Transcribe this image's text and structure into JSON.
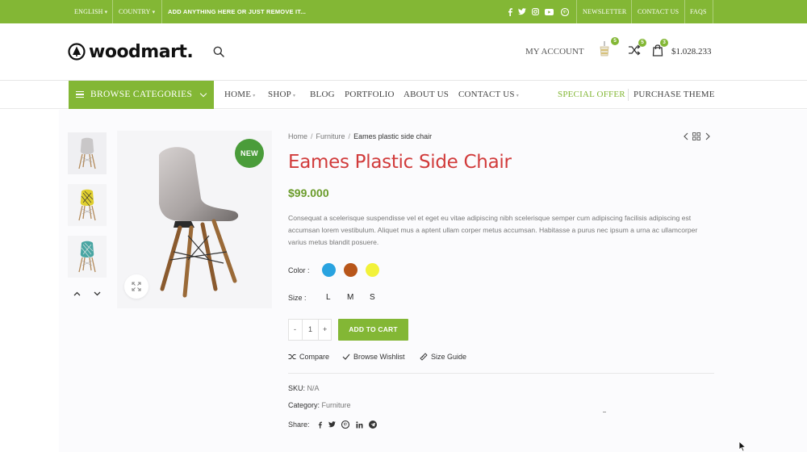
{
  "topbar": {
    "language": "ENGLISH",
    "country": "COUNTRY",
    "promo": "ADD ANYTHING HERE OR JUST REMOVE IT...",
    "social_icons": [
      "facebook-icon",
      "twitter-icon",
      "instagram-icon",
      "youtube-icon",
      "pinterest-icon"
    ],
    "links": [
      "NEWSLETTER",
      "CONTACT US",
      "FAQS"
    ]
  },
  "header": {
    "logo_text": "woodmart.",
    "my_account": "MY ACCOUNT",
    "wishlist_count": "5",
    "compare_count": "5",
    "cart_count": "3",
    "cart_total": "$1.028.233"
  },
  "nav": {
    "browse_label": "BROWSE CATEGORIES",
    "items": [
      "HOME",
      "SHOP",
      "BLOG",
      "PORTFOLIO",
      "ABOUT US",
      "CONTACT US"
    ],
    "special_offer": "SPECIAL OFFER",
    "purchase_theme": "PURCHASE THEME"
  },
  "product": {
    "badge": "NEW",
    "breadcrumb": [
      "Home",
      "Furniture",
      "Eames plastic side chair"
    ],
    "title": "Eames Plastic Side Chair",
    "price": "$99.000",
    "description": "Consequat a scelerisque suspendisse vel et eget eu vitae adipiscing nibh scelerisque semper cum adipiscing facilisis adipiscing est accumsan lorem vestibulum. Aliquet mus a aptent ullam corper metus accumsan. Habitasse a purus nec ipsum a urna ac ullamcorper varius metus blandit posuere.",
    "color_label": "Color :",
    "colors": [
      "#29a3e0",
      "#b8561a",
      "#f2f23a"
    ],
    "size_label": "Size :",
    "sizes": [
      "L",
      "M",
      "S"
    ],
    "qty_minus": "-",
    "qty_value": "1",
    "qty_plus": "+",
    "add_to_cart": "ADD TO CART",
    "compare": "Compare",
    "wishlist": "Browse Wishlist",
    "size_guide": "Size Guide",
    "sku_label": "SKU:",
    "sku_value": "N/A",
    "category_label": "Category:",
    "category_value": "Furniture",
    "share_label": "Share:",
    "share_icons": [
      "facebook-icon",
      "twitter-icon",
      "pinterest-icon",
      "linkedin-icon",
      "telegram-icon"
    ]
  },
  "colors": {
    "brand_green": "#83b735",
    "title_red": "#d13b3b",
    "price_green": "#6a9b2a"
  }
}
